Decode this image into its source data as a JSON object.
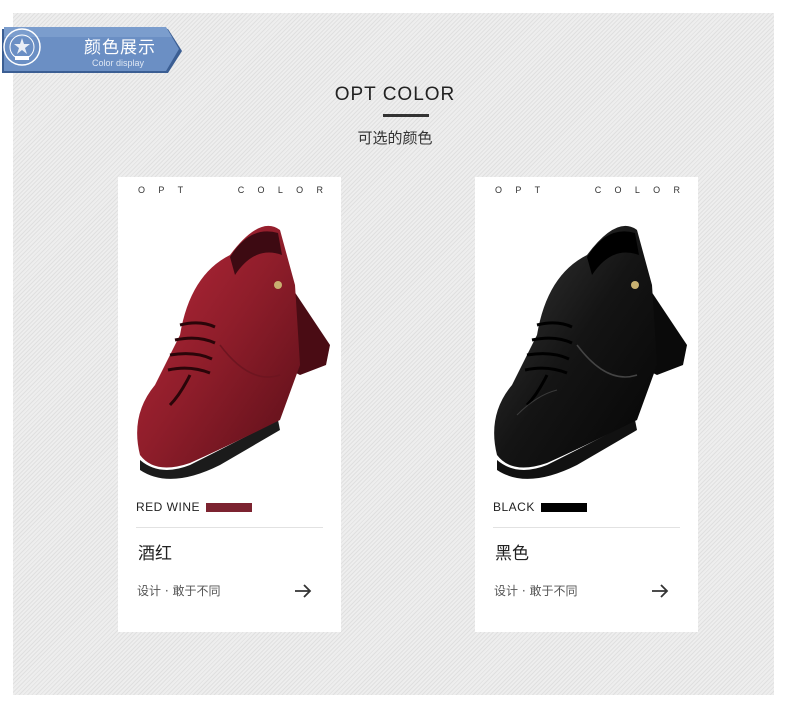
{
  "banner": {
    "title": "颜色展示",
    "subtitle": "Color display",
    "logo_icon": "brand-seal-logo",
    "color": "#5b7fb4"
  },
  "section": {
    "title": "OPT COLOR",
    "subtitle": "可选的颜色"
  },
  "cards": [
    {
      "header_letters": [
        "O",
        "P",
        "T",
        "C",
        "O",
        "L",
        "O",
        "R"
      ],
      "color_code": "RED WINE",
      "swatch_color": "#7c2330",
      "name": "酒红",
      "slogan": "设计 · 敢于不同",
      "arrow_icon": "arrow-right-icon"
    },
    {
      "header_letters": [
        "O",
        "P",
        "T",
        "C",
        "O",
        "L",
        "O",
        "R"
      ],
      "color_code": "BLACK",
      "swatch_color": "#000000",
      "name": "黑色",
      "slogan": "设计 · 敢于不同",
      "arrow_icon": "arrow-right-icon"
    }
  ]
}
